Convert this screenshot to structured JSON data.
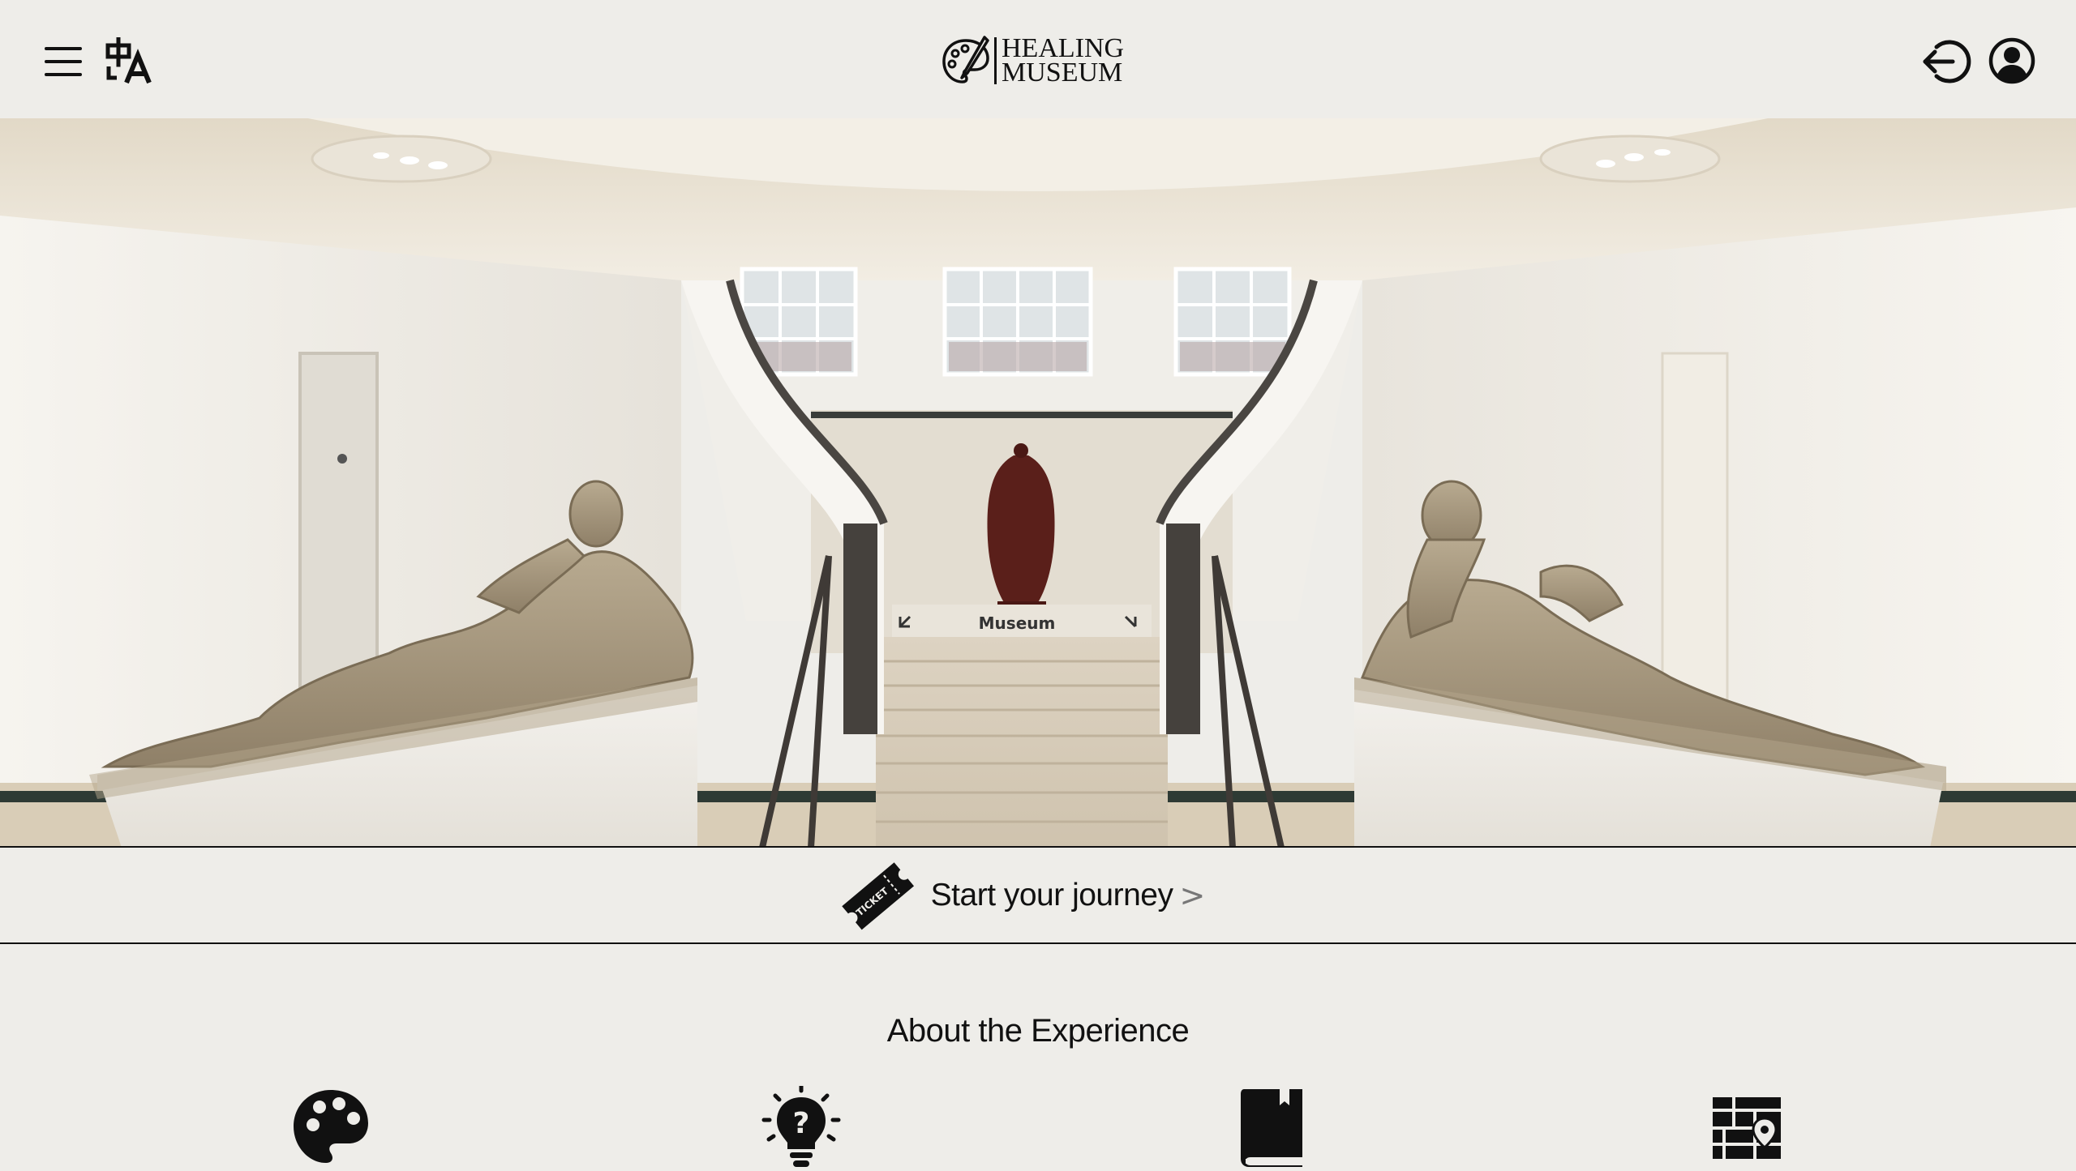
{
  "header": {
    "menu_icon": "hamburger-menu-icon",
    "translate_icon": "translate-icon",
    "logo": {
      "icon": "palette-brush-icon",
      "line1": "HEALING",
      "line2": "MUSEUM"
    },
    "logout_icon": "logout-arrow-icon",
    "account_icon": "user-circle-icon"
  },
  "hero": {
    "sign_text": "Museum",
    "description_icon": "museum-staircase-photo"
  },
  "journey": {
    "icon": "ticket-icon",
    "ticket_text": "TICKET",
    "label": "Start your journey",
    "chevron": ">"
  },
  "about": {
    "title": "About the Experience",
    "features": [
      {
        "icon": "palette-icon"
      },
      {
        "icon": "lightbulb-question-icon"
      },
      {
        "icon": "book-icon"
      },
      {
        "icon": "map-pin-icon"
      }
    ]
  },
  "colors": {
    "background": "#eeede9",
    "text": "#111111",
    "accent": "#000000"
  }
}
